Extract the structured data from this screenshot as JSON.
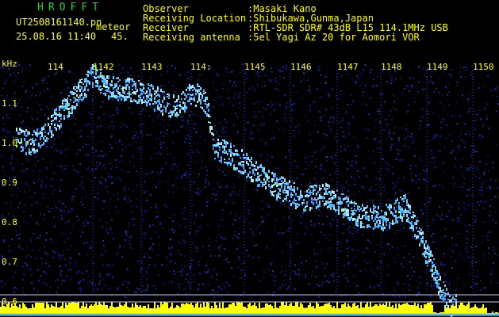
{
  "app": {
    "title": "HROFFT"
  },
  "file": {
    "name": "UT2508161140.pn",
    "event_type": "meteor"
  },
  "capture": {
    "datetime": "25.08.16 11:40",
    "count": "45."
  },
  "info": {
    "labels": [
      "Observer",
      "Receiving Location",
      "Receiver",
      "Receiving antenna"
    ],
    "values": [
      ":Masaki Kano",
      ":Shibukawa,Gunma,Japan",
      ":RTL-SDR SDR# 43dB L15 114.1MHz USB",
      ":5el Yagi Az 20 for Aomori VOR"
    ]
  },
  "axis": {
    "y_unit": "kHz",
    "y_ticks": [
      "1.1",
      "1.0",
      "0.9",
      "0.8",
      "0.7",
      "0.6"
    ],
    "x_ticks": [
      "114",
      "1142",
      "1143",
      "114:",
      "1145",
      "1146",
      "1147",
      "1148",
      "1149",
      "1150"
    ]
  },
  "colors": {
    "text": "#ffff00",
    "title": "#22cc44",
    "background": "#000000",
    "noise": "#0a1a6e",
    "signal": "#6fd7ff"
  }
}
